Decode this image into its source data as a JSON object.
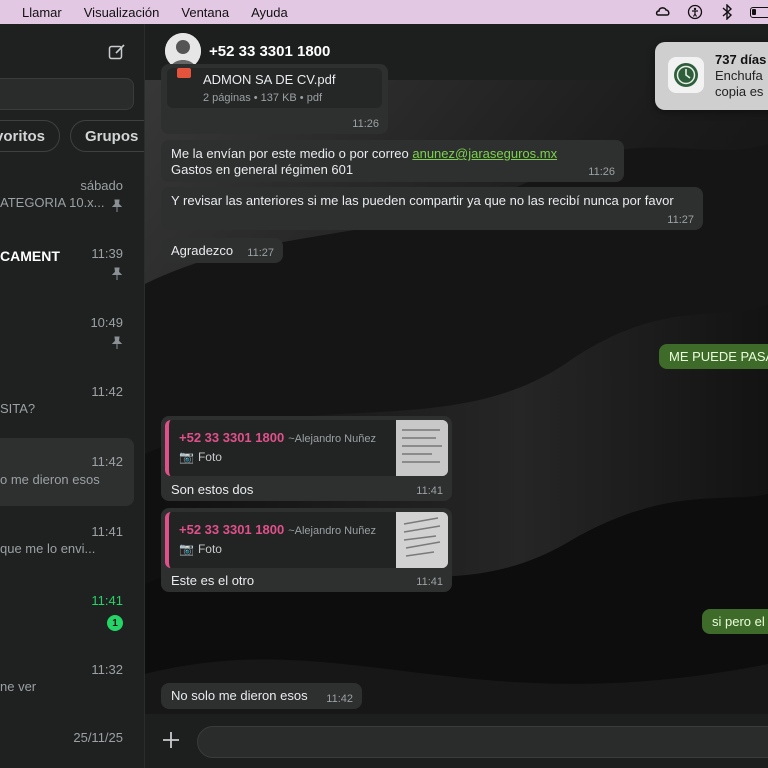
{
  "menubar": {
    "items": [
      "Llamar",
      "Visualización",
      "Ventana",
      "Ayuda"
    ],
    "status_icons": [
      "creative-cloud-icon",
      "accessibility-icon",
      "bluetooth-icon",
      "battery-icon"
    ]
  },
  "sidebar": {
    "filters": [
      "Favoritos",
      "Grupos"
    ],
    "chats": [
      {
        "name": "",
        "preview": "ATEGORIA 10.x...",
        "time": "sábado",
        "pinned": true
      },
      {
        "name": "CAMENT",
        "preview": "",
        "time": "11:39",
        "pinned": true
      },
      {
        "name": "",
        "preview": "",
        "time": "10:49",
        "pinned": true
      },
      {
        "name": "",
        "preview": "SITA?",
        "time": "11:42",
        "pinned": false
      },
      {
        "name": "",
        "preview": "o me dieron esos",
        "time": "11:42",
        "pinned": false,
        "active": true
      },
      {
        "name": "",
        "preview": "que me lo envi...",
        "time": "11:41",
        "pinned": false
      },
      {
        "name": "",
        "preview": "",
        "time": "11:41",
        "pinned": false,
        "unread": "1"
      },
      {
        "name": "",
        "preview": "ne ver",
        "time": "11:32",
        "pinned": false
      },
      {
        "name": "",
        "preview": "",
        "time": "25/11/25",
        "pinned": false
      }
    ]
  },
  "chat": {
    "contact": "+52 33 3301 1800",
    "messages": {
      "doc_name": "ADMON SA DE CV.pdf",
      "doc_meta": "2 páginas • 137 KB • pdf",
      "doc_time": "11:26",
      "m1_text": "Me la envían por este medio o por correo ",
      "m1_email": "anunez@jaraseguros.mx",
      "m1_text2": "Gastos en general régimen 601",
      "m1_time": "11:26",
      "m2_text": "Y revisar las anteriores si me las pueden compartir ya que no las recibí nunca por favor",
      "m2_time": "11:27",
      "m3_text": "Agradezco",
      "m3_time": "11:27",
      "out1_text": "ME PUEDE PASA",
      "q1_name": "+52 33 3301 1800",
      "q1_alias": "~Alejandro Nuñez",
      "q1_type": "Foto",
      "m4_text": "Son estos dos",
      "m4_time": "11:41",
      "q2_name": "+52 33 3301 1800",
      "q2_alias": "~Alejandro Nuñez",
      "q2_type": "Foto",
      "m5_text": "Este es el otro",
      "m5_time": "11:41",
      "out2_text": "si pero el",
      "m6_text": "No solo me dieron esos",
      "m6_time": "11:42"
    }
  },
  "notification": {
    "title": "737 días",
    "body": "Enchufa\ncopia es"
  },
  "colors": {
    "accent_green": "#25d366",
    "quote_pink": "#e0508a",
    "menubar": "#e3c8e3"
  }
}
